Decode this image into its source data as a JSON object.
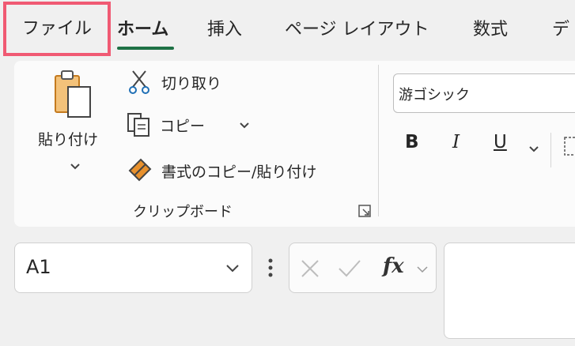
{
  "tabs": {
    "file": "ファイル",
    "home": "ホーム",
    "insert": "挿入",
    "page_layout": "ページ レイアウト",
    "formulas": "数式",
    "data_partial": "デ"
  },
  "clipboard": {
    "paste_label": "貼り付け",
    "cut_label": "切り取り",
    "copy_label": "コピー",
    "format_painter_label": "書式のコピー/貼り付け",
    "group_label": "クリップボード"
  },
  "font": {
    "font_name": "游ゴシック",
    "bold": "B",
    "italic": "I",
    "underline": "U"
  },
  "formula_bar": {
    "name_box_value": "A1",
    "fx_label": "fx",
    "formula_value": ""
  },
  "colors": {
    "highlight": "#f05a73",
    "home_underline": "#1e7145",
    "format_painter_orange": "#e8912d"
  }
}
